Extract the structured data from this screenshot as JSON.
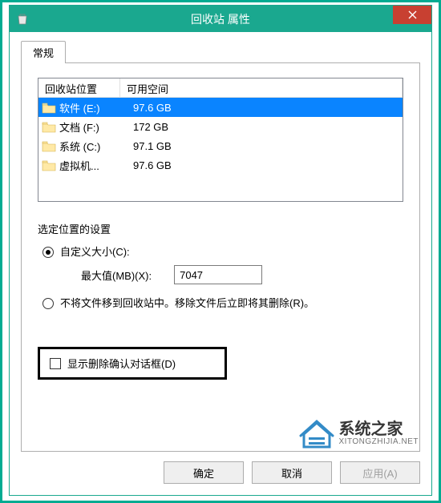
{
  "title": "回收站 属性",
  "tab_label": "常规",
  "columns": {
    "location": "回收站位置",
    "space": "可用空间"
  },
  "rows": [
    {
      "name": "软件 (E:)",
      "space": "97.6 GB",
      "selected": true
    },
    {
      "name": "文档 (F:)",
      "space": "172 GB",
      "selected": false
    },
    {
      "name": "系统 (C:)",
      "space": "97.1 GB",
      "selected": false
    },
    {
      "name": "虚拟机...",
      "space": "97.6 GB",
      "selected": false
    }
  ],
  "settings_label": "选定位置的设置",
  "radio_custom": "自定义大小(C):",
  "max_label": "最大值(MB)(X):",
  "max_value": "7047",
  "radio_skip": "不将文件移到回收站中。移除文件后立即将其删除(R)。",
  "checkbox_confirm": "显示删除确认对话框(D)",
  "buttons": {
    "ok": "确定",
    "cancel": "取消",
    "apply": "应用(A)"
  },
  "watermark": {
    "cn": "系统之家",
    "en": "XITONGZHIJIA.NET"
  }
}
